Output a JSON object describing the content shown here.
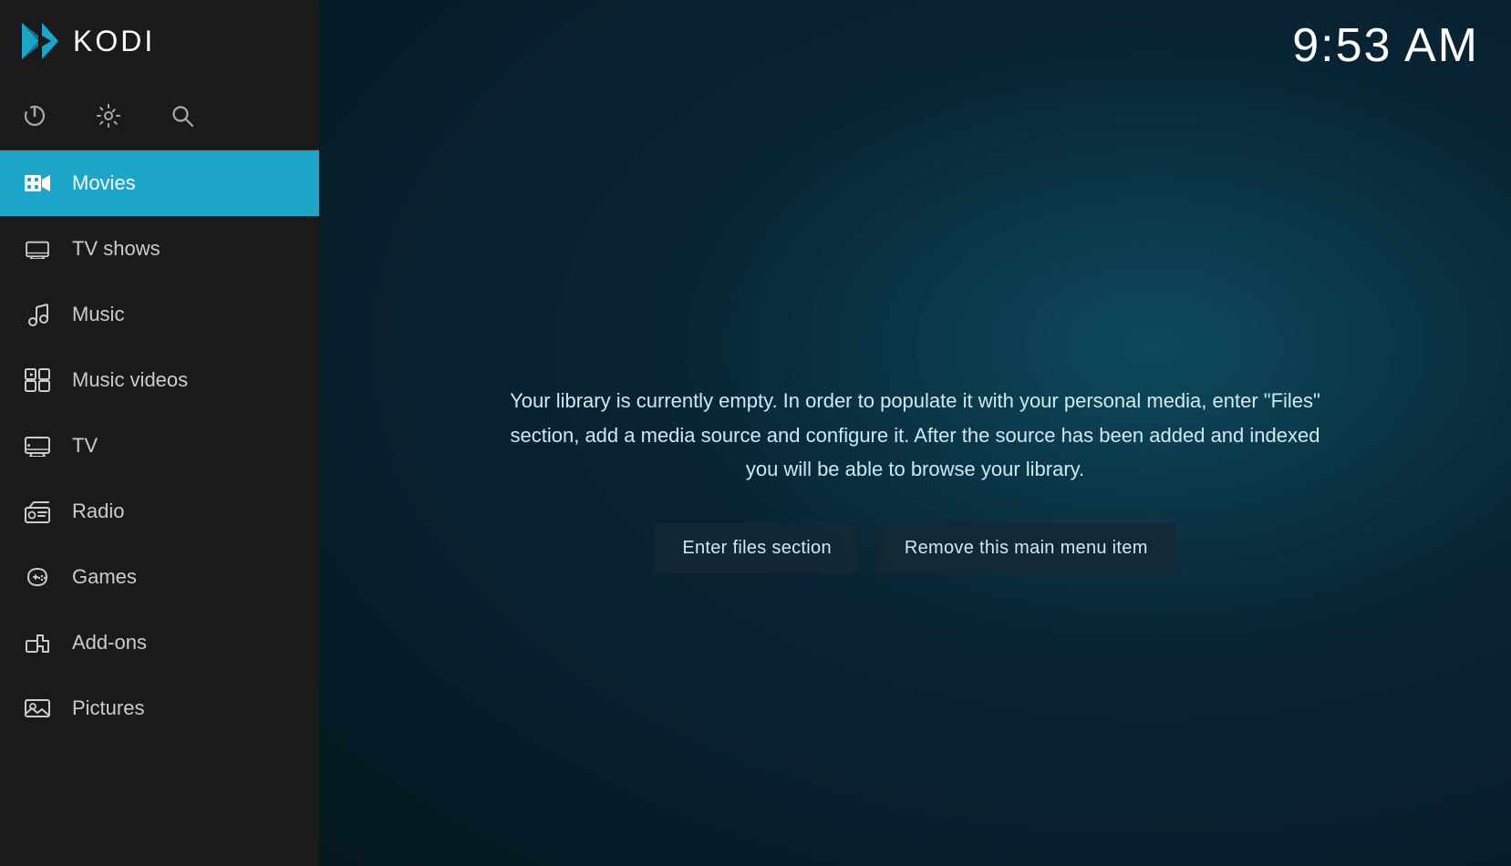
{
  "app": {
    "name": "KODI",
    "clock": "9:53 AM"
  },
  "sidebar": {
    "nav_items": [
      {
        "id": "movies",
        "label": "Movies",
        "active": true
      },
      {
        "id": "tv-shows",
        "label": "TV shows",
        "active": false
      },
      {
        "id": "music",
        "label": "Music",
        "active": false
      },
      {
        "id": "music-videos",
        "label": "Music videos",
        "active": false
      },
      {
        "id": "tv",
        "label": "TV",
        "active": false
      },
      {
        "id": "radio",
        "label": "Radio",
        "active": false
      },
      {
        "id": "games",
        "label": "Games",
        "active": false
      },
      {
        "id": "add-ons",
        "label": "Add-ons",
        "active": false
      },
      {
        "id": "pictures",
        "label": "Pictures",
        "active": false
      }
    ],
    "controls": {
      "power": "⏻",
      "settings": "⚙",
      "search": "🔍"
    }
  },
  "main": {
    "empty_library_message": "Your library is currently empty. In order to populate it with your personal media, enter \"Files\" section, add a media source and configure it. After the source has been added and indexed you will be able to browse your library.",
    "btn_enter_files": "Enter files section",
    "btn_remove_menu": "Remove this main menu item"
  }
}
